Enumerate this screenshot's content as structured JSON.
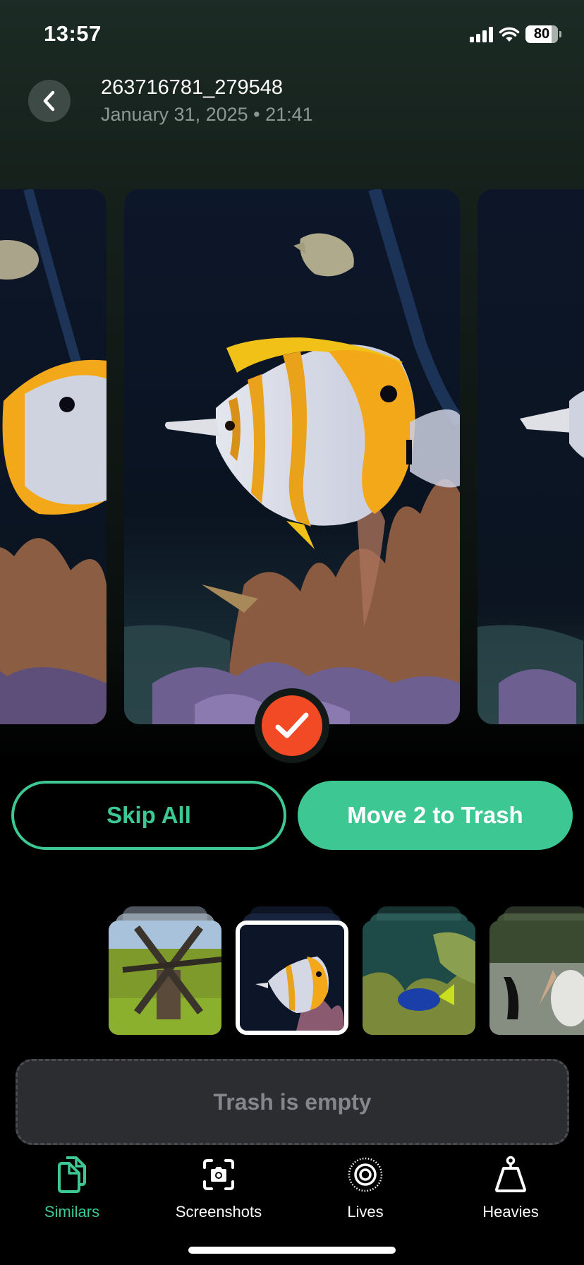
{
  "status_bar": {
    "time": "13:57",
    "battery_level": "80",
    "icons": [
      "cellular-signal-icon",
      "wifi-icon",
      "battery-icon"
    ]
  },
  "header": {
    "back_icon": "chevron-left-icon",
    "title": "263716781_279548",
    "subtitle": "January 31, 2025 • 21:41"
  },
  "carousel": {
    "photos": [
      {
        "description": "Butterflyfish in aquarium (previous)",
        "position": "left"
      },
      {
        "description": "Copperband butterflyfish swimming above coral",
        "position": "center",
        "selected": true
      },
      {
        "description": "Butterflyfish in aquarium (next)",
        "position": "right"
      }
    ],
    "selected_badge_icon": "checkmark-icon"
  },
  "actions": {
    "skip_label": "Skip All",
    "move_label": "Move 2 to Trash"
  },
  "thumbnails": [
    {
      "description": "Wooden windmill in park",
      "selected": false
    },
    {
      "description": "Butterflyfish in aquarium",
      "selected": true
    },
    {
      "description": "Blue tang among coral reef",
      "selected": false
    },
    {
      "description": "Pelican and cormorant by pond",
      "selected": false
    }
  ],
  "trash": {
    "label": "Trash is empty"
  },
  "tab_bar": {
    "items": [
      {
        "label": "Similars",
        "icon": "documents-icon",
        "active": true
      },
      {
        "label": "Screenshots",
        "icon": "screenshot-camera-icon",
        "active": false
      },
      {
        "label": "Lives",
        "icon": "live-photo-icon",
        "active": false
      },
      {
        "label": "Heavies",
        "icon": "weight-icon",
        "active": false
      }
    ]
  },
  "colors": {
    "accent": "#3dc893",
    "check_badge": "#f24a24",
    "trash_bg": "#2c2d31"
  }
}
